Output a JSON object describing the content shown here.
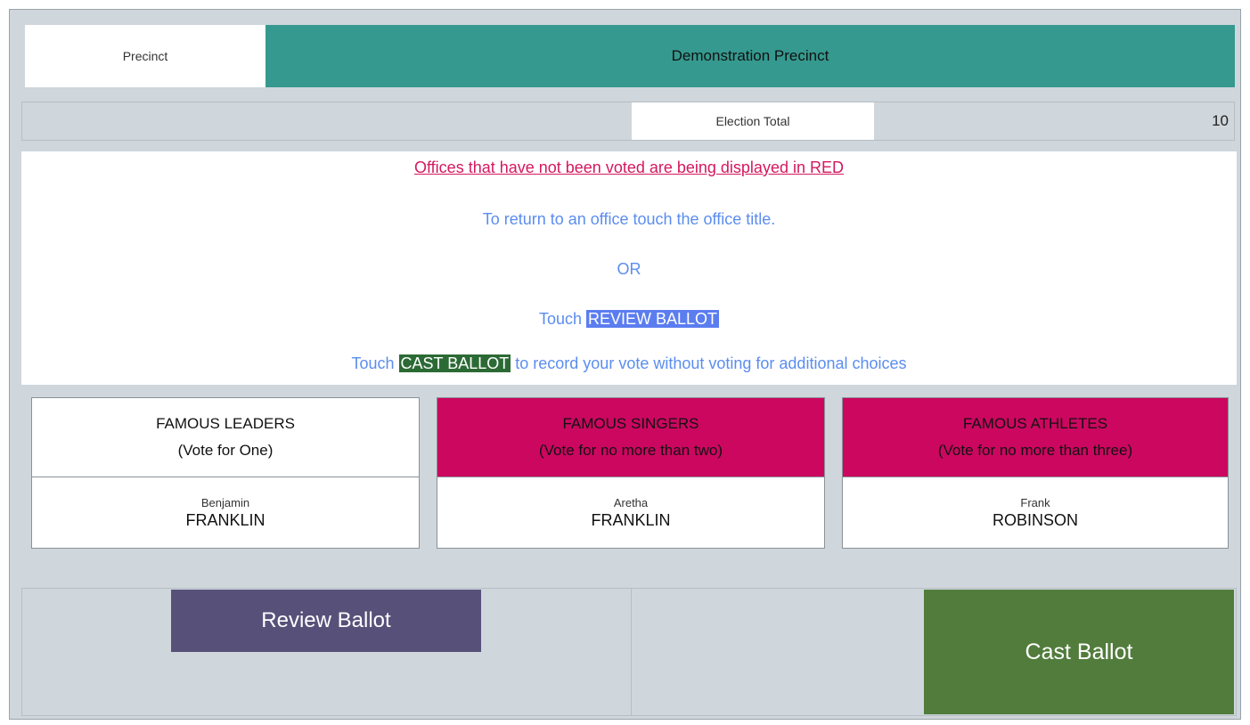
{
  "header": {
    "precinct_label": "Precinct",
    "precinct_name": "Demonstration Precinct"
  },
  "totals": {
    "label": "Election Total",
    "value": "10"
  },
  "instructions": {
    "warning": "Offices that have not been voted are being displayed in RED",
    "return_line": "To return to an office touch the office title.",
    "or": "OR",
    "touch_prefix": "Touch",
    "review_highlight": "REVIEW BALLOT",
    "cast_prefix": "Touch",
    "cast_highlight": "CAST BALLOT",
    "cast_suffix": "to record your vote without voting for additional choices"
  },
  "offices": [
    {
      "title": "FAMOUS LEADERS",
      "rule": "(Vote for One)",
      "status": "voted",
      "candidate_first": "Benjamin",
      "candidate_last": "FRANKLIN"
    },
    {
      "title": "FAMOUS SINGERS",
      "rule": "(Vote for no more than two)",
      "status": "unvoted",
      "candidate_first": "Aretha",
      "candidate_last": "FRANKLIN"
    },
    {
      "title": "FAMOUS ATHLETES",
      "rule": "(Vote for no more than three)",
      "status": "unvoted",
      "candidate_first": "Frank",
      "candidate_last": "ROBINSON"
    }
  ],
  "buttons": {
    "review": "Review Ballot",
    "cast": "Cast Ballot"
  },
  "colors": {
    "header_teal": "#35998f",
    "unvoted_red": "#cc0760",
    "review_purple": "#57517a",
    "cast_green": "#517c3c",
    "instruction_blue": "#5b8df0"
  }
}
